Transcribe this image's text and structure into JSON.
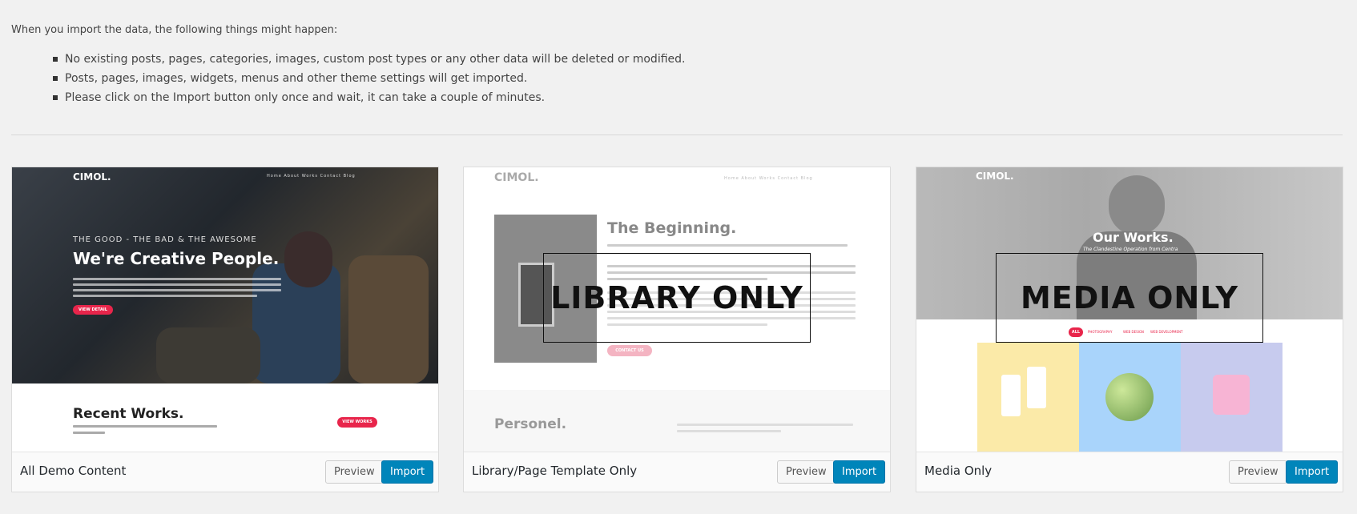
{
  "intro": "When you import the data, the following things might happen:",
  "notes": [
    "No existing posts, pages, categories, images, custom post types or any other data will be deleted or modified.",
    "Posts, pages, images, widgets, menus and other theme settings will get imported.",
    "Please click on the Import button only once and wait, it can take a couple of minutes."
  ],
  "cards": [
    {
      "title": "All Demo Content",
      "preview": "Preview",
      "import": "Import",
      "shot": {
        "logo": "CIMOL.",
        "nav": "Home  About  Works  Contact  Blog",
        "tagline": "THE GOOD - THE BAD & THE AWESOME",
        "heading": "We're Creative People.",
        "button": "VIEW DETAIL",
        "section": "Recent Works.",
        "section_button": "VIEW WORKS"
      }
    },
    {
      "title": "Library/Page Template Only",
      "preview": "Preview",
      "import": "Import",
      "shot": {
        "logo": "CIMOL.",
        "nav": "Home  About  Works  Contact  Blog",
        "heading": "The Beginning.",
        "button": "CONTACT US",
        "section": "Personel.",
        "badge": "LIBRARY ONLY"
      }
    },
    {
      "title": "Media Only",
      "preview": "Preview",
      "import": "Import",
      "shot": {
        "logo": "CIMOL.",
        "heading": "Our Works.",
        "subheading": "The Clandestine Operation from Centra",
        "filters": [
          "ALL",
          "PHOTOGRAPHY",
          "WEB DESIGN",
          "WEB DEVELOPMENT"
        ],
        "badge": "MEDIA ONLY"
      }
    }
  ],
  "colors": {
    "accent": "#e8254b",
    "import_button": "#0085ba",
    "tile_yellow": "#fbeaa8",
    "tile_blue": "#a9d4fb",
    "tile_lavender": "#c7cbee"
  }
}
